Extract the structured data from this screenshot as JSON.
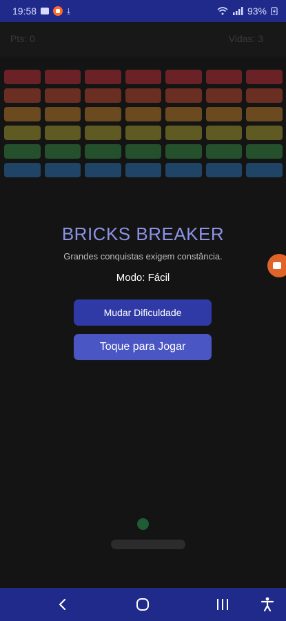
{
  "status": {
    "time": "19:58",
    "battery": "93%"
  },
  "hud": {
    "points": "Pts: 0",
    "lives": "Vidas: 3"
  },
  "bricks": {
    "columns": 7,
    "rows": [
      {
        "color": "#6b2226"
      },
      {
        "color": "#6a2e22"
      },
      {
        "color": "#6a4a1e"
      },
      {
        "color": "#5f5a22"
      },
      {
        "color": "#24502c"
      },
      {
        "color": "#1f4466"
      }
    ]
  },
  "menu": {
    "title": "BRICKS BREAKER",
    "subtitle": "Grandes conquistas exigem constância.",
    "mode": "Modo: Fácil",
    "difficulty_button": "Mudar Dificuldade",
    "play_button": "Toque para Jogar"
  },
  "icons": {
    "message": "message-icon",
    "record": "screen-record-icon",
    "download": "download-icon",
    "wifi": "wifi-icon",
    "signal": "signal-icon",
    "battery": "battery-charging-icon",
    "back": "back-icon",
    "home": "home-icon",
    "recents": "recents-icon",
    "accessibility": "accessibility-icon"
  },
  "colors": {
    "status_bar": "#1f2a8a",
    "background": "#141414",
    "title": "#8c93e6",
    "button_primary": "#2f3aa6",
    "button_secondary": "#4a56c4",
    "ball": "#1e5c33"
  }
}
